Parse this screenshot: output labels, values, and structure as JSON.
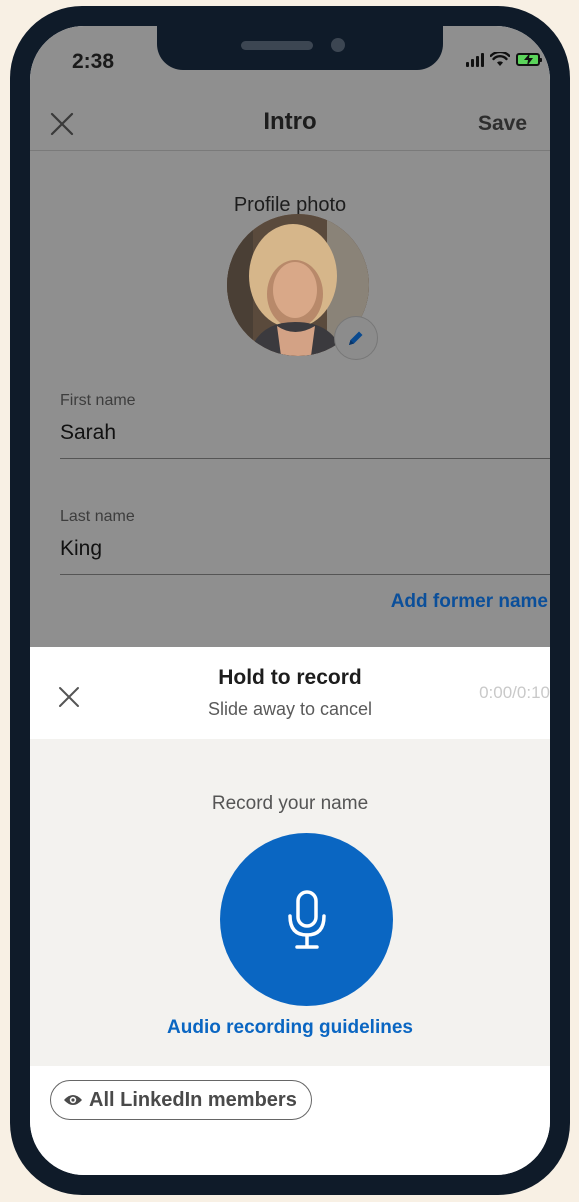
{
  "status_bar": {
    "time": "2:38"
  },
  "nav": {
    "title": "Intro",
    "save_label": "Save"
  },
  "profile": {
    "photo_label": "Profile photo"
  },
  "fields": {
    "first_name": {
      "label": "First name",
      "value": "Sarah"
    },
    "last_name": {
      "label": "Last name",
      "value": "King"
    }
  },
  "add_former_name": "Add former name",
  "recorder": {
    "title": "Hold to record",
    "subtitle": "Slide away to cancel",
    "timer": "0:00/0:10",
    "record_label": "Record your name",
    "guidelines_link": "Audio recording guidelines"
  },
  "visibility": {
    "label": "All LinkedIn members",
    "icon": "eye-icon"
  },
  "colors": {
    "accent": "#0a66c2",
    "link": "#0b4f9a",
    "phone_frame": "#0f1b29",
    "background": "#f8f0e4"
  }
}
